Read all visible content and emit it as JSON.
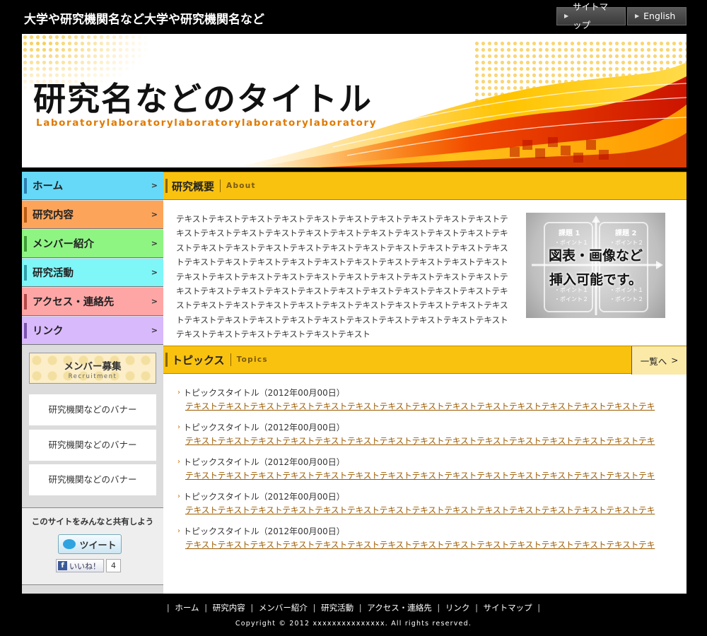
{
  "header": {
    "org_name": "大学や研究機関名など大学や研究機関名など",
    "links": [
      {
        "label": "サイトマップ"
      },
      {
        "label": "English"
      }
    ]
  },
  "banner": {
    "title": "研究名などのタイトル",
    "subtitle": "Laboratorylaboratorylaboratorylaboratorylaboratory"
  },
  "sidebar": {
    "nav": [
      {
        "label": "ホーム",
        "color": "#66d9f8",
        "bar_color": "#2b7fb0"
      },
      {
        "label": "研究内容",
        "color": "#fca45a",
        "bar_color": "#b85a13"
      },
      {
        "label": "メンバー紹介",
        "color": "#8ef583",
        "bar_color": "#3f9b36"
      },
      {
        "label": "研究活動",
        "color": "#7ff6f7",
        "bar_color": "#2f9fa8"
      },
      {
        "label": "アクセス・連絡先",
        "color": "#fea6a6",
        "bar_color": "#b24747"
      },
      {
        "label": "リンク",
        "color": "#d8b9fb",
        "bar_color": "#7a52b0"
      }
    ],
    "recruit": {
      "title": "メンバー募集",
      "subtitle": "Recruitment"
    },
    "banners": [
      {
        "label": "研究機関などのバナー"
      },
      {
        "label": "研究機関などのバナー"
      },
      {
        "label": "研究機関などのバナー"
      }
    ],
    "share": {
      "label": "このサイトをみんなと共有しよう",
      "tweet_label": "ツイート",
      "like_label": "いいね！",
      "like_count": "4"
    }
  },
  "about": {
    "title": "研究概要",
    "subtitle": "About",
    "text": "テキストテキストテキストテキストテキストテキストテキストテキストテキストテキストテキストテキストテキストテキストテキストテキストテキストテキストテキストテキストテキストテキストテキストテキストテキストテキストテキストテキストテキストテキストテキストテキストテキストテキストテキストテキストテキストテキストテキストテキストテキストテキストテキストテキストテキストテキストテキストテキストテキストテキストテキストテキストテキストテキストテキストテキストテキストテキストテキストテキストテキストテキストテキストテキストテキストテキストテキストテキストテキストテキストテキストテキストテキストテキストテキストテキストテキストテキストテキストテキストテキストテキストテキストテキストテキストテキストテキストテキスト",
    "image": {
      "line1": "図表・画像など",
      "line2": "挿入可能です。",
      "label_left": "課題 1",
      "label_right": "課題 2",
      "point1": "・ポイント１",
      "point2": "・ポイント２"
    }
  },
  "topics": {
    "title": "トピックス",
    "subtitle": "Topics",
    "more_label": "一覧へ",
    "items": [
      {
        "title": "トピックスタイトル（2012年00月00日）",
        "link": "テキストテキストテキストテキストテキストテキストテキストテキストテキストテキストテキストテキストテキストテキストテキ"
      },
      {
        "title": "トピックスタイトル（2012年00月00日）",
        "link": "テキストテキストテキストテキストテキストテキストテキストテキストテキストテキストテキストテキストテキストテキストテキ"
      },
      {
        "title": "トピックスタイトル（2012年00月00日）",
        "link": "テキストテキストテキストテキストテキストテキストテキストテキストテキストテキストテキストテキストテキストテキストテキ"
      },
      {
        "title": "トピックスタイトル（2012年00月00日）",
        "link": "テキストテキストテキストテキストテキストテキストテキストテキストテキストテキストテキストテキストテキストテキストテキ"
      },
      {
        "title": "トピックスタイトル（2012年00月00日）",
        "link": "テキストテキストテキストテキストテキストテキストテキストテキストテキストテキストテキストテキストテキストテキストテキ"
      }
    ]
  },
  "footer": {
    "nav": [
      "ホーム",
      "研究内容",
      "メンバー紹介",
      "研究活動",
      "アクセス・連絡先",
      "リンク",
      "サイトマップ"
    ],
    "copyright": "Copyright © 2012 xxxxxxxxxxxxxxx. All rights reserved."
  }
}
